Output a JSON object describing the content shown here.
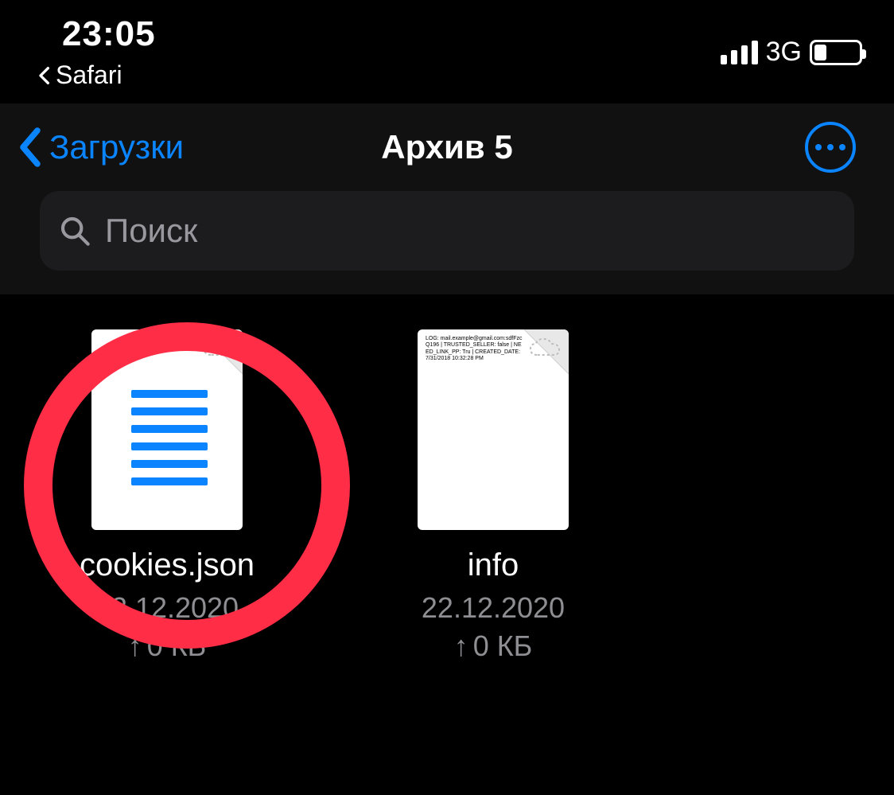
{
  "status": {
    "time": "23:05",
    "back_app_label": "Safari",
    "network_type": "3G"
  },
  "nav": {
    "back_label": "Загрузки",
    "title": "Архив 5"
  },
  "search": {
    "placeholder": "Поиск"
  },
  "files": [
    {
      "name": "cookies.json",
      "date": "22.12.2020",
      "size": "0 КБ",
      "highlighted": true,
      "type": "json"
    },
    {
      "name": "info",
      "date": "22.12.2020",
      "size": "0 КБ",
      "highlighted": false,
      "type": "txt"
    }
  ]
}
